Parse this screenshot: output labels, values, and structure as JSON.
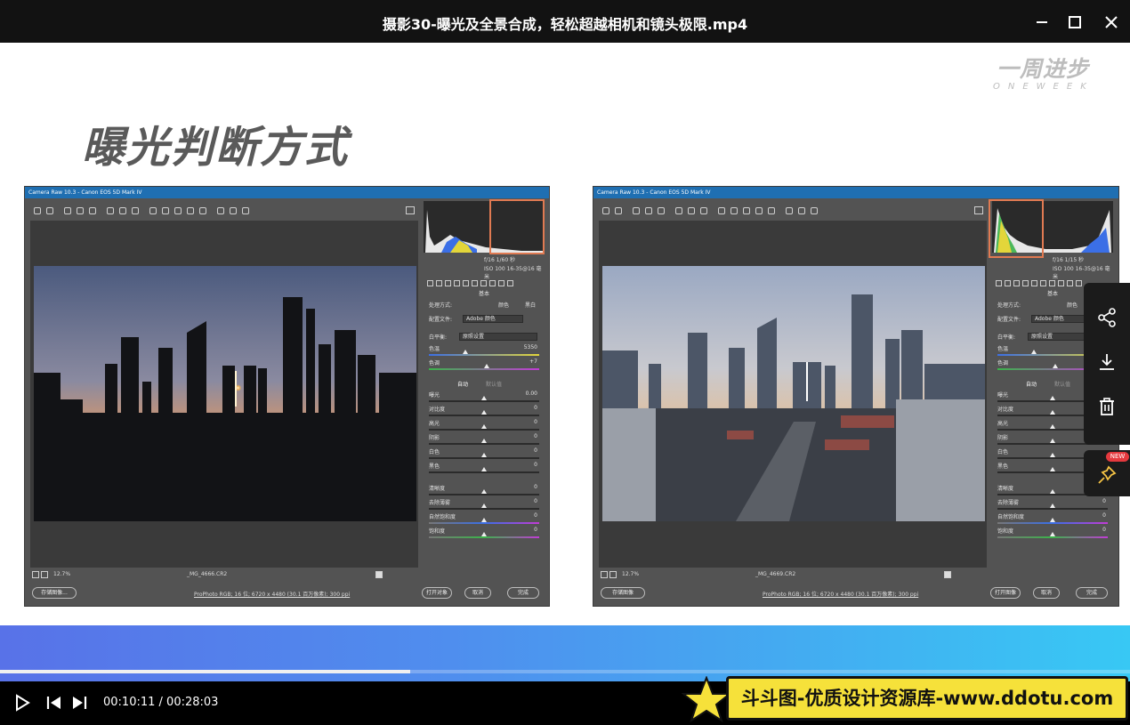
{
  "window": {
    "title": "摄影30-曝光及全景合成，轻松超越相机和镜头极限.mp4",
    "icons": {
      "minimize": "minimize-icon",
      "maximize": "maximize-icon",
      "close": "close-icon"
    }
  },
  "slide": {
    "brand_cn": "一周进步",
    "brand_en": "ONEWEEK",
    "heading": "曝光判断方式"
  },
  "left_window": {
    "title": "Camera Raw 10.3 - Canon EOS 5D Mark IV",
    "exif": {
      "aperture_shutter": "f/16  1/60 秒",
      "iso_lens": "ISO 100   16-35@16 毫米"
    },
    "panel_title": "基本",
    "process_label": "处理方式:",
    "process_color": "颜色",
    "process_bw": "黑白",
    "profile_label": "配置文件:",
    "profile_value": "Adobe 颜色",
    "wb_label": "白平衡:",
    "wb_value": "原照设置",
    "temp_label": "色温",
    "temp_value": "5350",
    "tint_label": "色调",
    "tint_value": "+7",
    "auto": "自动",
    "default": "默认值",
    "exposure_label": "曝光",
    "exposure_value": "0.00",
    "contrast_label": "对比度",
    "contrast_value": "0",
    "highlights_label": "高光",
    "highlights_value": "0",
    "shadows_label": "阴影",
    "shadows_value": "0",
    "whites_label": "白色",
    "whites_value": "0",
    "blacks_label": "黑色",
    "blacks_value": "0",
    "clarity_label": "清晰度",
    "clarity_value": "0",
    "dehaze_label": "去除薄雾",
    "dehaze_value": "0",
    "vibrance_label": "自然饱和度",
    "vibrance_value": "0",
    "saturation_label": "饱和度",
    "saturation_value": "0",
    "zoom": "12.7%",
    "filename": "_MG_4666.CR2",
    "save": "存储图像...",
    "info": "ProPhoto RGB; 16 位; 6720 x 4480 (30.1 百万像素); 300 ppi",
    "open": "打开对象",
    "cancel": "取消",
    "done": "完成"
  },
  "right_window": {
    "title": "Camera Raw 10.3 - Canon EOS 5D Mark IV",
    "exif": {
      "aperture_shutter": "f/16  1/15 秒",
      "iso_lens": "ISO 100   16-35@16 毫米"
    },
    "panel_title": "基本",
    "process_label": "处理方式:",
    "process_color": "颜色",
    "profile_label": "配置文件:",
    "profile_value": "Adobe 颜色",
    "wb_label": "白平衡:",
    "wb_value": "原照设置",
    "temp_label": "色温",
    "tint_label": "色调",
    "auto": "自动",
    "default": "默认值",
    "exposure_label": "曝光",
    "contrast_label": "对比度",
    "highlights_label": "高光",
    "shadows_label": "阴影",
    "whites_label": "白色",
    "blacks_label": "黑色",
    "clarity_label": "清晰度",
    "dehaze_label": "去除薄雾",
    "dehaze_value": "0",
    "vibrance_label": "自然饱和度",
    "vibrance_value": "0",
    "saturation_label": "饱和度",
    "saturation_value": "0",
    "zoom": "12.7%",
    "filename": "_MG_4669.CR2",
    "save": "存储图像",
    "info": "ProPhoto RGB; 16 位; 6720 x 4480 (30.1 百万像素); 300 ppi",
    "open": "打开图像",
    "cancel": "取消",
    "done": "完成"
  },
  "sidebar": {
    "icons": [
      "share-icon",
      "download-icon",
      "trash-icon",
      "pin-icon"
    ],
    "new_badge": "NEW"
  },
  "player": {
    "current_time": "00:10:11",
    "separator": " / ",
    "duration": "00:28:03",
    "progress_fraction": 0.363,
    "icons": [
      "play-icon",
      "previous-icon",
      "next-icon"
    ]
  },
  "watermark": {
    "text": "斗斗图-优质设计资源库-www.ddotu.com"
  },
  "colors": {
    "highlight_box": "#e07a52",
    "acr_title_bar": "#1f6fb2",
    "new_badge": "#e5393e",
    "watermark_bg": "#f6e13a"
  }
}
